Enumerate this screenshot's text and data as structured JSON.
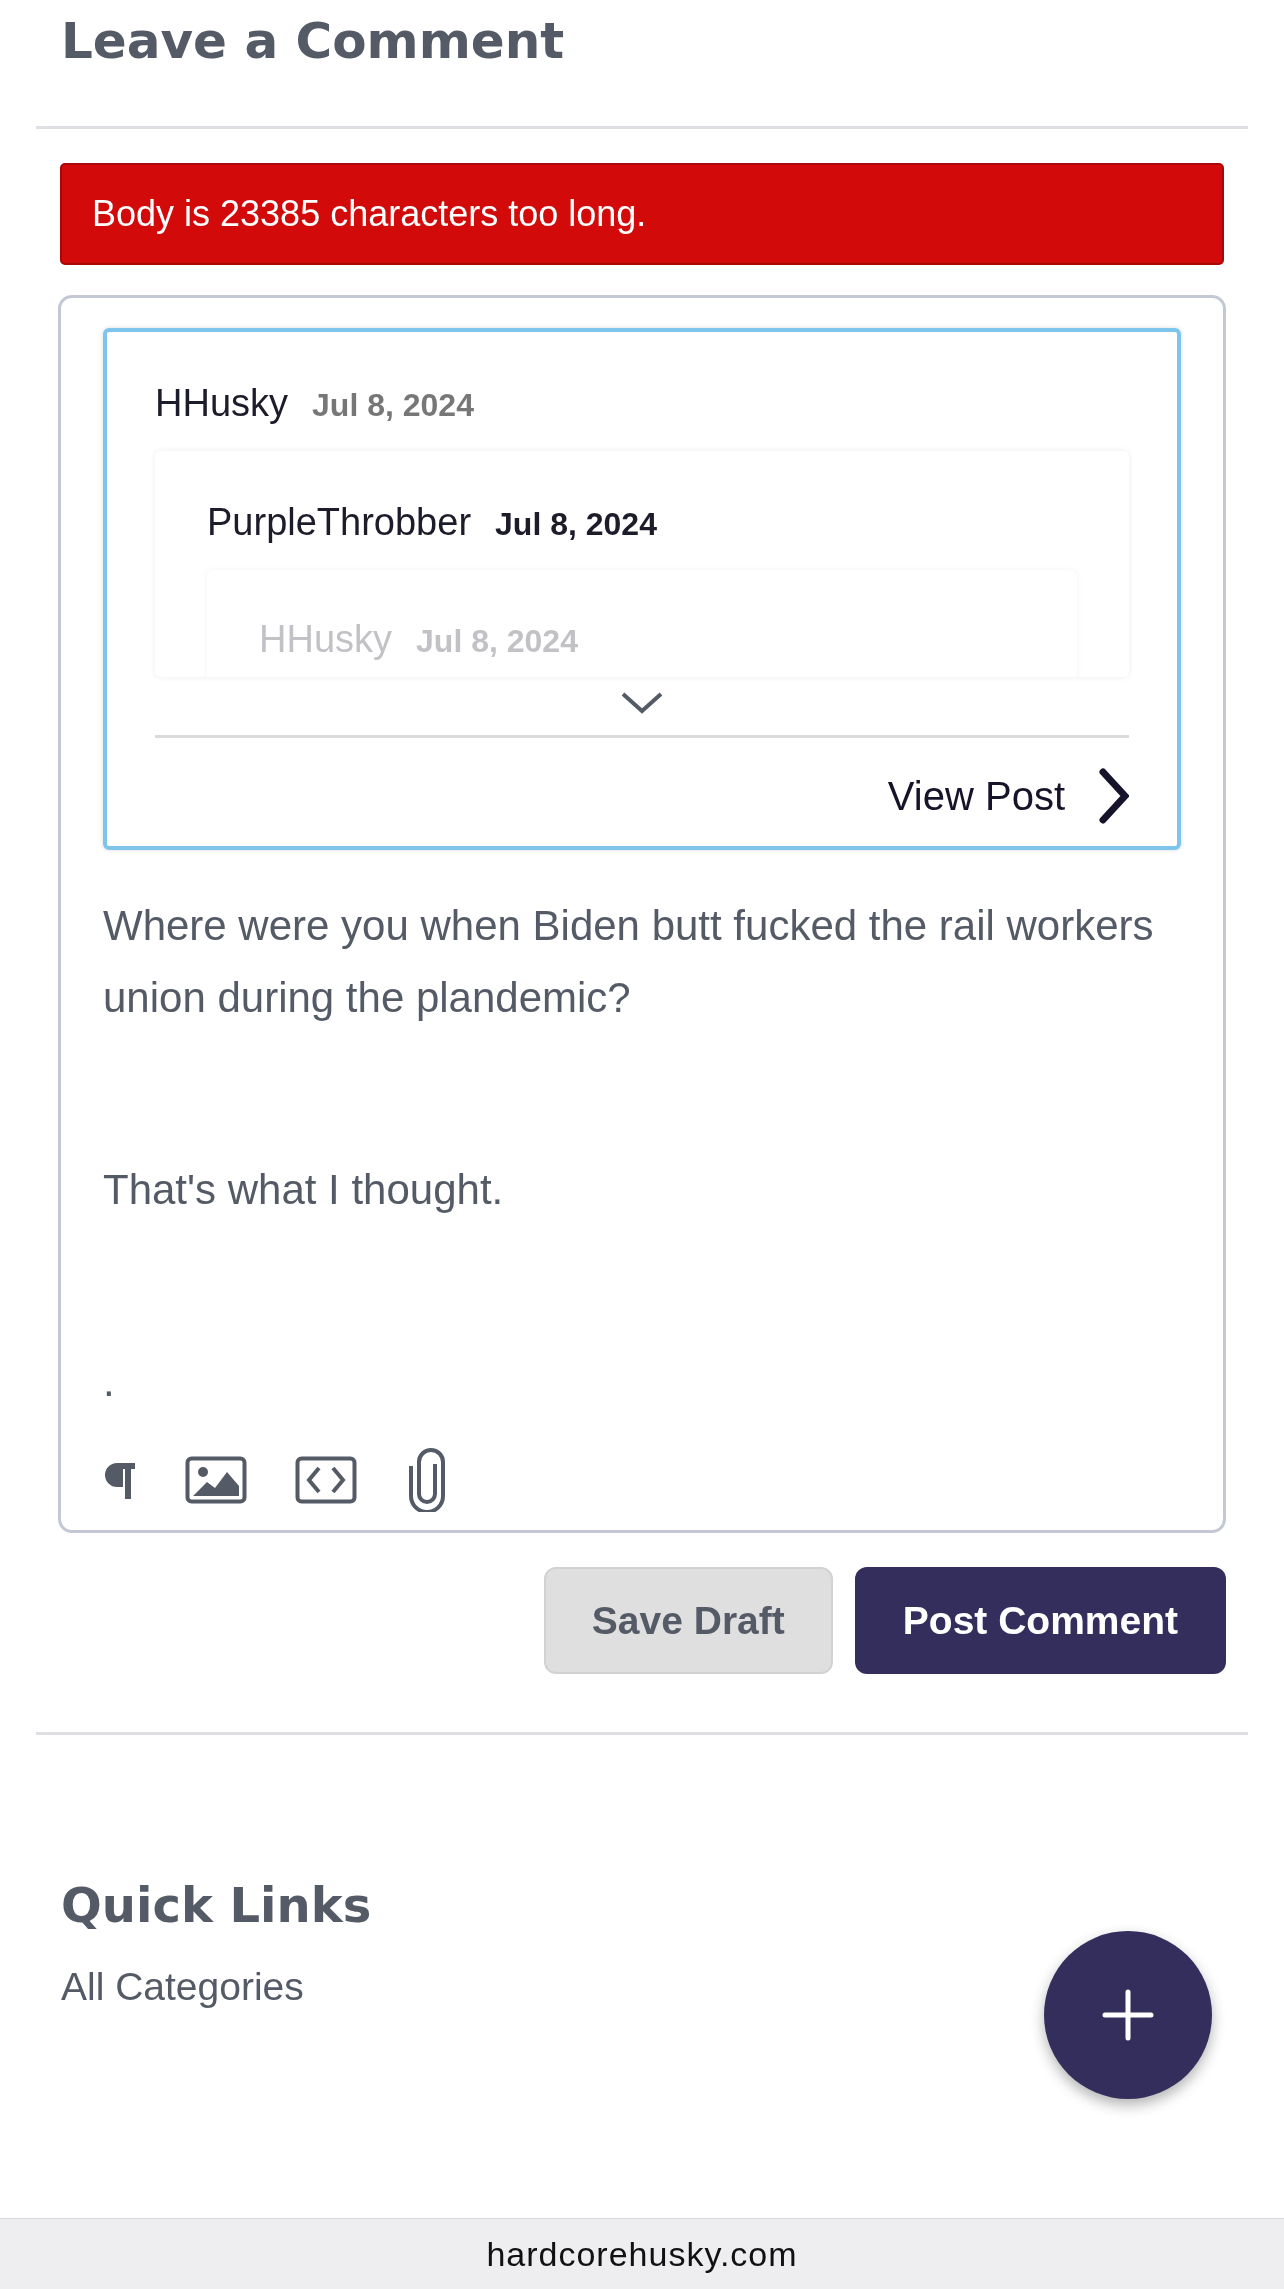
{
  "heading": "Leave a Comment",
  "error": "Body is 23385 characters too long.",
  "quote": {
    "author": "HHusky",
    "date": "Jul 8, 2024",
    "quote": {
      "author": "PurpleThrobber",
      "date": "Jul 8, 2024",
      "quote": {
        "author": "HHusky",
        "date": "Jul 8, 2024"
      }
    }
  },
  "view_post": "View Post",
  "body": [
    "Where were you when Biden butt fucked the rail workers union during the plandemic?",
    "That's what I thought.",
    "."
  ],
  "toolbar": [
    {
      "kind": "paragraph"
    },
    {
      "kind": "image"
    },
    {
      "kind": "code"
    },
    {
      "kind": "attach"
    }
  ],
  "buttons": [
    {
      "label": "Save Draft",
      "kind": "secondary"
    },
    {
      "label": "Post Comment",
      "kind": "primary"
    }
  ],
  "quick_links": {
    "title": "Quick Links",
    "items": [
      "All Categories"
    ]
  },
  "url": "hardcorehusky.com"
}
